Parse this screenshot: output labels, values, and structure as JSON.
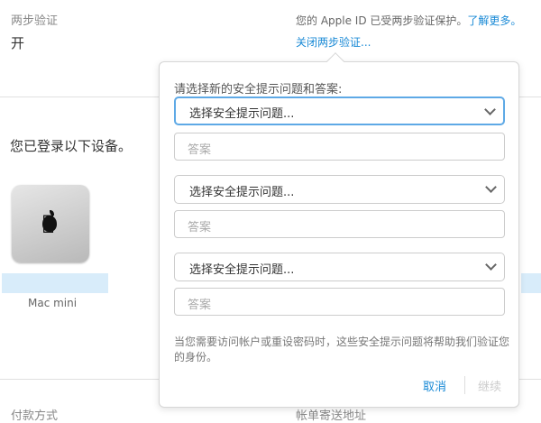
{
  "two_step": {
    "title": "两步验证",
    "status": "开",
    "description": "您的 Apple ID 已受两步验证保护。",
    "learn_more": "了解更多。",
    "turn_off": "关闭两步验证..."
  },
  "devices": {
    "title": "您已登录以下设备。",
    "items": [
      {
        "model": "Mac mini",
        "icon": "apple-logo-icon"
      }
    ]
  },
  "bottom": {
    "payment": "付款方式",
    "billing_address": "帐单寄送地址"
  },
  "popover": {
    "prompt": "请选择新的安全提示问题和答案:",
    "questions": [
      {
        "select": "选择安全提示问题...",
        "answer_placeholder": "答案"
      },
      {
        "select": "选择安全提示问题...",
        "answer_placeholder": "答案"
      },
      {
        "select": "选择安全提示问题...",
        "answer_placeholder": "答案"
      }
    ],
    "help": "当您需要访问帐户或重设密码时，这些安全提示问题将帮助我们验证您的身份。",
    "cancel": "取消",
    "continue": "继续"
  },
  "colors": {
    "accent": "#1a8ad6",
    "focus": "#5ea9e6"
  }
}
